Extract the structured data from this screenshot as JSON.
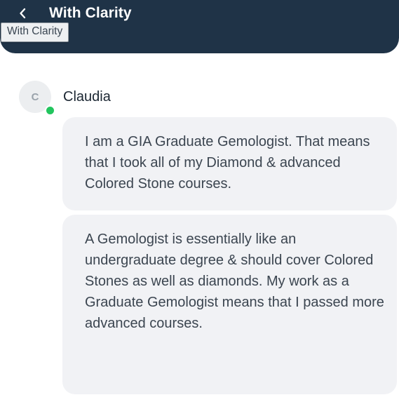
{
  "header": {
    "title": "With Clarity",
    "back_icon": "chevron-left-icon",
    "background_color": "#1f3347"
  },
  "tooltip": {
    "text": "With Clarity"
  },
  "sender": {
    "initial": "C",
    "name": "Claudia",
    "status_color": "#22c55e"
  },
  "messages": [
    {
      "text": "I am a GIA Graduate Gemologist. That means that I took all of my Diamond & advanced Colored Stone courses."
    },
    {
      "text": "A Gemologist is essentially like an undergraduate degree & should cover Colored Stones as well as diamonds. My work as a Graduate Gemologist means that I passed more advanced courses."
    }
  ]
}
